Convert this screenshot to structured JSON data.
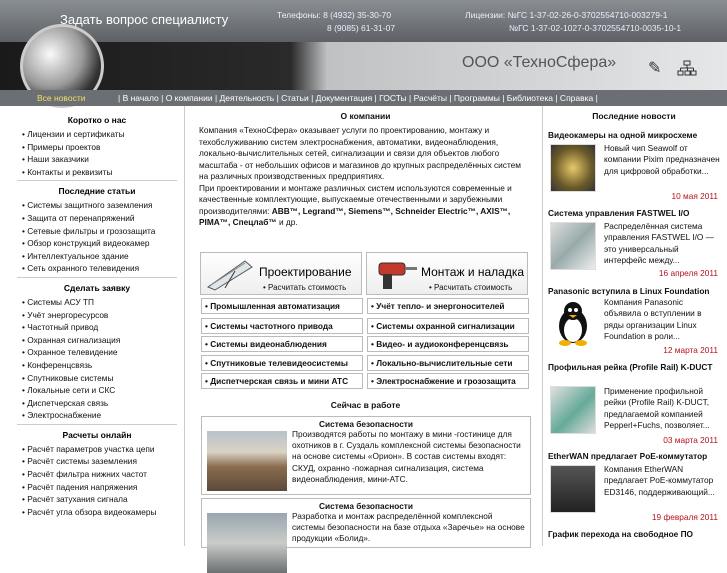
{
  "topbar": {
    "ask": "Задать вопрос специалисту",
    "phones_line1": "Телефоны: 8 (4932) 35-30-70",
    "phones_line2": "8 (9085) 61-31-07",
    "licenses_line1": "Лицензии: №ГС 1-37-02-26-0-3702554710-003279-1",
    "licenses_line2": "№ГС 1-37-02-1027-0-3702554710-0035-10-1"
  },
  "header": {
    "company": "ООО «ТехноСфера»"
  },
  "nav": {
    "all_news": "Все новости",
    "links": "| В начало | О компании | Деятельность | Статьи | Документация | ГОСТы | Расчёты | Программы | Библиотека | Справка |"
  },
  "left": {
    "brief_title": "Коротко о нас",
    "brief": [
      "Лицензии и сертификаты",
      "Примеры проектов",
      "Наши заказчики",
      "Контакты и реквизиты"
    ],
    "articles_title": "Последние статьи",
    "articles": [
      "Системы защитного заземления",
      "Защита от перенапряжений",
      "Сетевые фильтры и грозозащита",
      "Обзор конструкций видеокамер",
      "Интеллектуальное здание",
      "Сеть охранного телевидения"
    ],
    "order_title": "Сделать заявку",
    "order": [
      "Системы АСУ ТП",
      "Учёт энергоресурсов",
      "Частотный привод",
      "Охранная сигнализация",
      "Охранное телевидение",
      "Конференцсвязь",
      "Спутниковые системы",
      "Локальные сети и СКС",
      "Диспетчерская связь",
      "Электроснабжение"
    ],
    "calc_title": "Расчеты онлайн",
    "calc": [
      "Расчёт параметров участка цепи",
      "Расчёт системы заземления",
      "Расчёт фильтра нижних частот",
      "Расчёт падения напряжения",
      "Расчёт затухания сигнала",
      "Расчёт угла обзора видеокамеры"
    ]
  },
  "main": {
    "about_title": "О компании",
    "about_p1": "Компания «ТехноСфера» оказывает услуги по проектированию, монтажу и техобслуживанию систем электроснабжения, автоматики, видеонаблюдения, локально-вычислительных сетей, сигнализации и связи для объектов любого масштаба - от небольших офисов и магазинов до крупных распределённых систем на различных производственных предприятиях.",
    "about_p2": "При проектировании и монтаже различных систем используются современные и качественные комплектующие, выпускаемые отечественными и зарубежными производителями:",
    "about_brands": "ABB™, Legrand™, Siemens™, Schneider Electric™, AXIS™, PIMA™, Спецлаб™",
    "about_end": " и др.",
    "design_title": "Проектирование",
    "design_sub": "• Расчитать стоимость",
    "install_title": "Монтаж и наладка",
    "install_sub": "• Расчитать стоимость",
    "services_left": [
      "• Промышленная автоматизация",
      "• Системы частотного привода",
      "• Системы видеонаблюдения",
      "• Спутниковые телевидеосистемы",
      "• Диспетчерская связь и мини АТС"
    ],
    "services_right": [
      "• Учёт тепло- и энергоносителей",
      "• Системы охранной сигнализации",
      "• Видео- и аудиоконференцсвязь",
      "• Локально-вычислительные сети",
      "• Электроснабжение и грозозащита"
    ],
    "work_title": "Сейчас в работе",
    "work1_title": "Система безопасности",
    "work1_text": "Производятся работы по монтажу в мини -гостинице для охотников в г. Суздаль комплексной системы безопасности на основе системы «Орион». В состав системы входят: СКУД, охранно -пожарная сигнализация, система видеонаблюдения, мини-АТС.",
    "work2_title": "Система безопасности",
    "work2_text": "Разработка и монтаж распределённой комплексной системы безопасности на базе отдыха «Заречье» на основе продукции «Болид»."
  },
  "right": {
    "title": "Последние новости",
    "news": [
      {
        "title": "Видеокамеры на одной микросхеме",
        "text": "Новый чип Seawolf от компании Pixim предназначен для цифровой обработки...",
        "date": "10 мая 2011"
      },
      {
        "title": "Система управления FASTWEL I/O",
        "text": "Распределённая система управления FASTWEL I/O — это универсальный интерфейс между...",
        "date": "16 апреля 2011"
      },
      {
        "title": "Panasonic вступила в Linux Foundation",
        "text": "Компания Panasonic объявила о вступлении в ряды организации Linux Foundation в роли...",
        "date": "12 марта 2011"
      },
      {
        "title": "Профильная рейка (Profile Rail) K-DUCT",
        "text": "Применение профильной рейки (Profile Rail) K-DUCT, предлагаемой компанией Pepperl+Fuchs, позволяет...",
        "date": "03 марта 2011"
      },
      {
        "title": "EtherWAN предлагает PoE-коммутатор",
        "text": "Компания EtherWAN предлагает PoE-коммутатор ED3146, поддерживающий...",
        "date": "19 февраля 2011"
      },
      {
        "title": "График перехода на свободное ПО",
        "text": "",
        "date": ""
      }
    ]
  }
}
